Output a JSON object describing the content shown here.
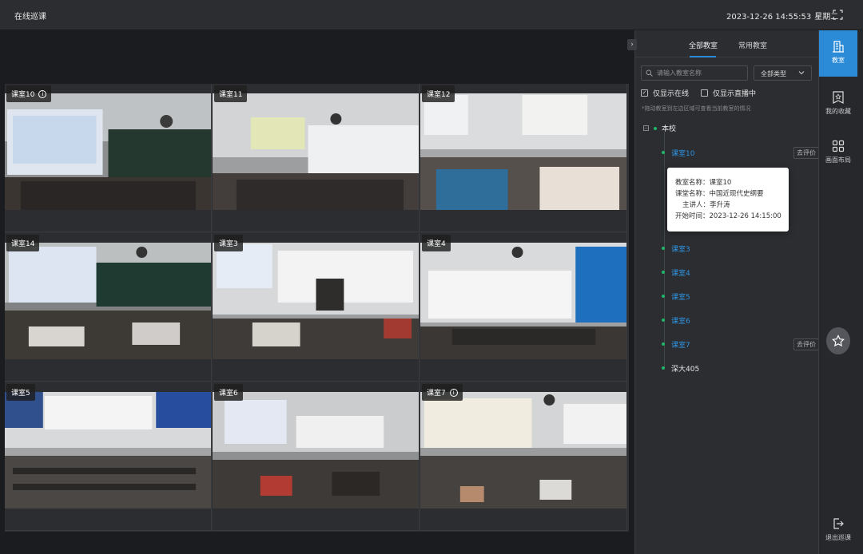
{
  "header": {
    "title": "在线巡课",
    "datetime": "2023-12-26 14:55:53",
    "weekday": "星期二"
  },
  "video_tiles": [
    {
      "label": "课室10",
      "has_info": true
    },
    {
      "label": "课室11",
      "has_info": false
    },
    {
      "label": "课室12",
      "has_info": false
    },
    {
      "label": "课室14",
      "has_info": false
    },
    {
      "label": "课室3",
      "has_info": false
    },
    {
      "label": "课室4",
      "has_info": false
    },
    {
      "label": "课室5",
      "has_info": false
    },
    {
      "label": "课室6",
      "has_info": false
    },
    {
      "label": "课室7",
      "has_info": true
    }
  ],
  "panel": {
    "tabs": [
      "全部教室",
      "常用教室"
    ],
    "search_placeholder": "请输入教室名称",
    "type_select": "全部类型",
    "checkbox_online": {
      "label": "仅显示在线",
      "checked": true
    },
    "checkbox_live": {
      "label": "仅显示直播中",
      "checked": false
    },
    "hint": "*拖动教室到左边区域可查看当前教室的情况",
    "tree_root": "本校",
    "tree_items": [
      {
        "label": "课室10",
        "eval": "去评价"
      },
      {
        "label": "课室3",
        "eval": ""
      },
      {
        "label": "课室4",
        "eval": ""
      },
      {
        "label": "课室5",
        "eval": ""
      },
      {
        "label": "课室6",
        "eval": ""
      },
      {
        "label": "课室7",
        "eval": "去评价"
      },
      {
        "label": "深大405",
        "eval": ""
      }
    ],
    "tooltip": {
      "room_label": "教室名称：",
      "room": "课室10",
      "course_label": "课堂名称：",
      "course": "中国近现代史纲要",
      "lecturer_label": "主讲人：",
      "lecturer": "李升涛",
      "start_label": "开始时间：",
      "start": "2023-12-26 14:15:00"
    }
  },
  "rail": {
    "classroom": "教室",
    "favorites": "我的收藏",
    "layout": "画面布局",
    "exit": "退出巡课"
  },
  "colors": {
    "accent": "#2b8bd6",
    "online_dot": "#1fb56b",
    "link": "#2f93e0"
  }
}
